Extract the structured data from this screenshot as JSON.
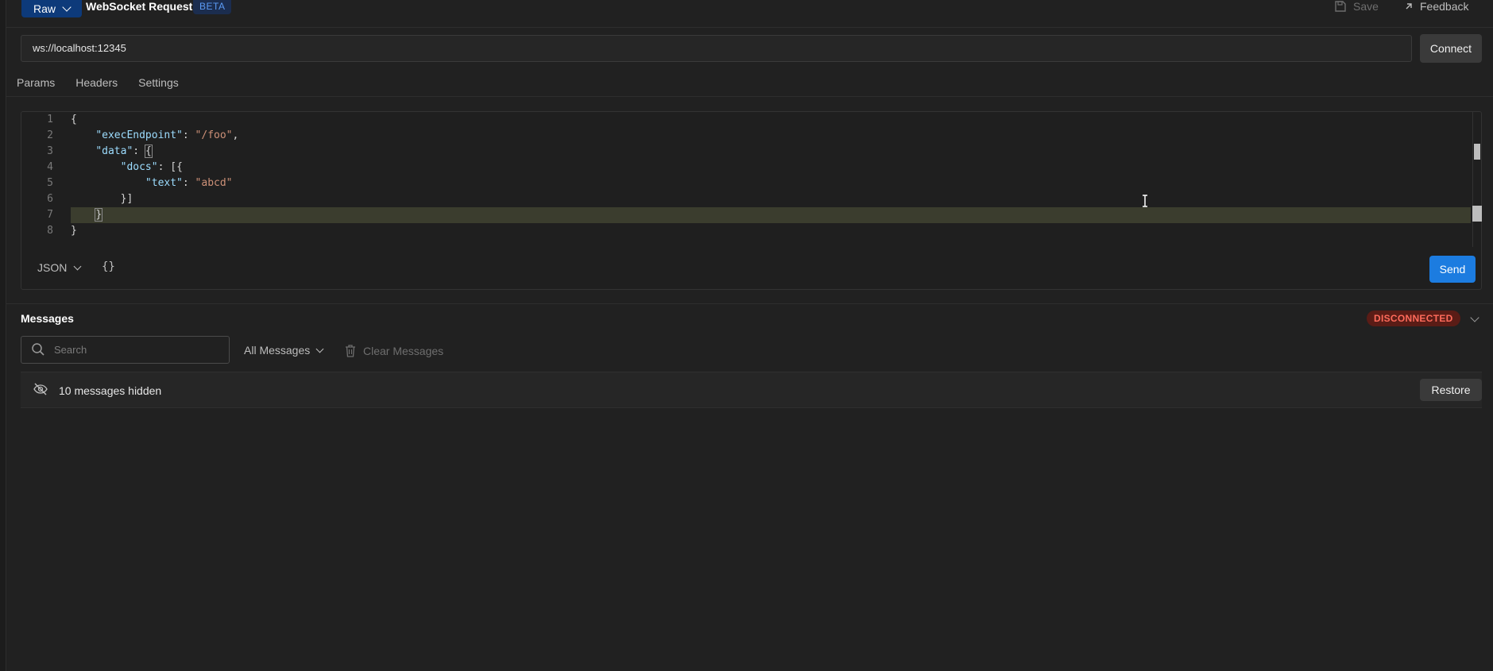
{
  "header": {
    "mode_label": "Raw",
    "title": "WebSocket Request",
    "badge": "BETA",
    "save_label": "Save",
    "feedback_label": "Feedback"
  },
  "url": {
    "value": "ws://localhost:12345",
    "connect_label": "Connect"
  },
  "tabs": [
    {
      "label": "Params"
    },
    {
      "label": "Headers"
    },
    {
      "label": "Settings"
    }
  ],
  "editor": {
    "lines": [
      "1",
      "2",
      "3",
      "4",
      "5",
      "6",
      "7",
      "8"
    ],
    "code": {
      "l1": "{",
      "l2_key": "\"execEndpoint\"",
      "l2_sep": ": ",
      "l2_val": "\"/foo\"",
      "l2_end": ",",
      "l3_key": "\"data\"",
      "l3_sep": ": ",
      "l3_br": "{",
      "l4_key": "\"docs\"",
      "l4_sep": ": [{",
      "l5_key": "\"text\"",
      "l5_sep": ": ",
      "l5_val": "\"abcd\"",
      "l6": "}]",
      "l7_br": "}",
      "l8": "}"
    },
    "language_label": "JSON",
    "format_label": "{}",
    "send_label": "Send"
  },
  "messages": {
    "title": "Messages",
    "status": "DISCONNECTED",
    "search_placeholder": "Search",
    "filter_label": "All Messages",
    "clear_label": "Clear Messages",
    "hidden_label": "10 messages hidden",
    "restore_label": "Restore"
  },
  "colors": {
    "background": "#212121",
    "accent": "#1c7ce0",
    "mode_button": "#0d3a7a",
    "status_bg": "#5a1c16",
    "status_text": "#ff6b5b",
    "json_key": "#9cdcfe",
    "json_string": "#ce9178"
  }
}
